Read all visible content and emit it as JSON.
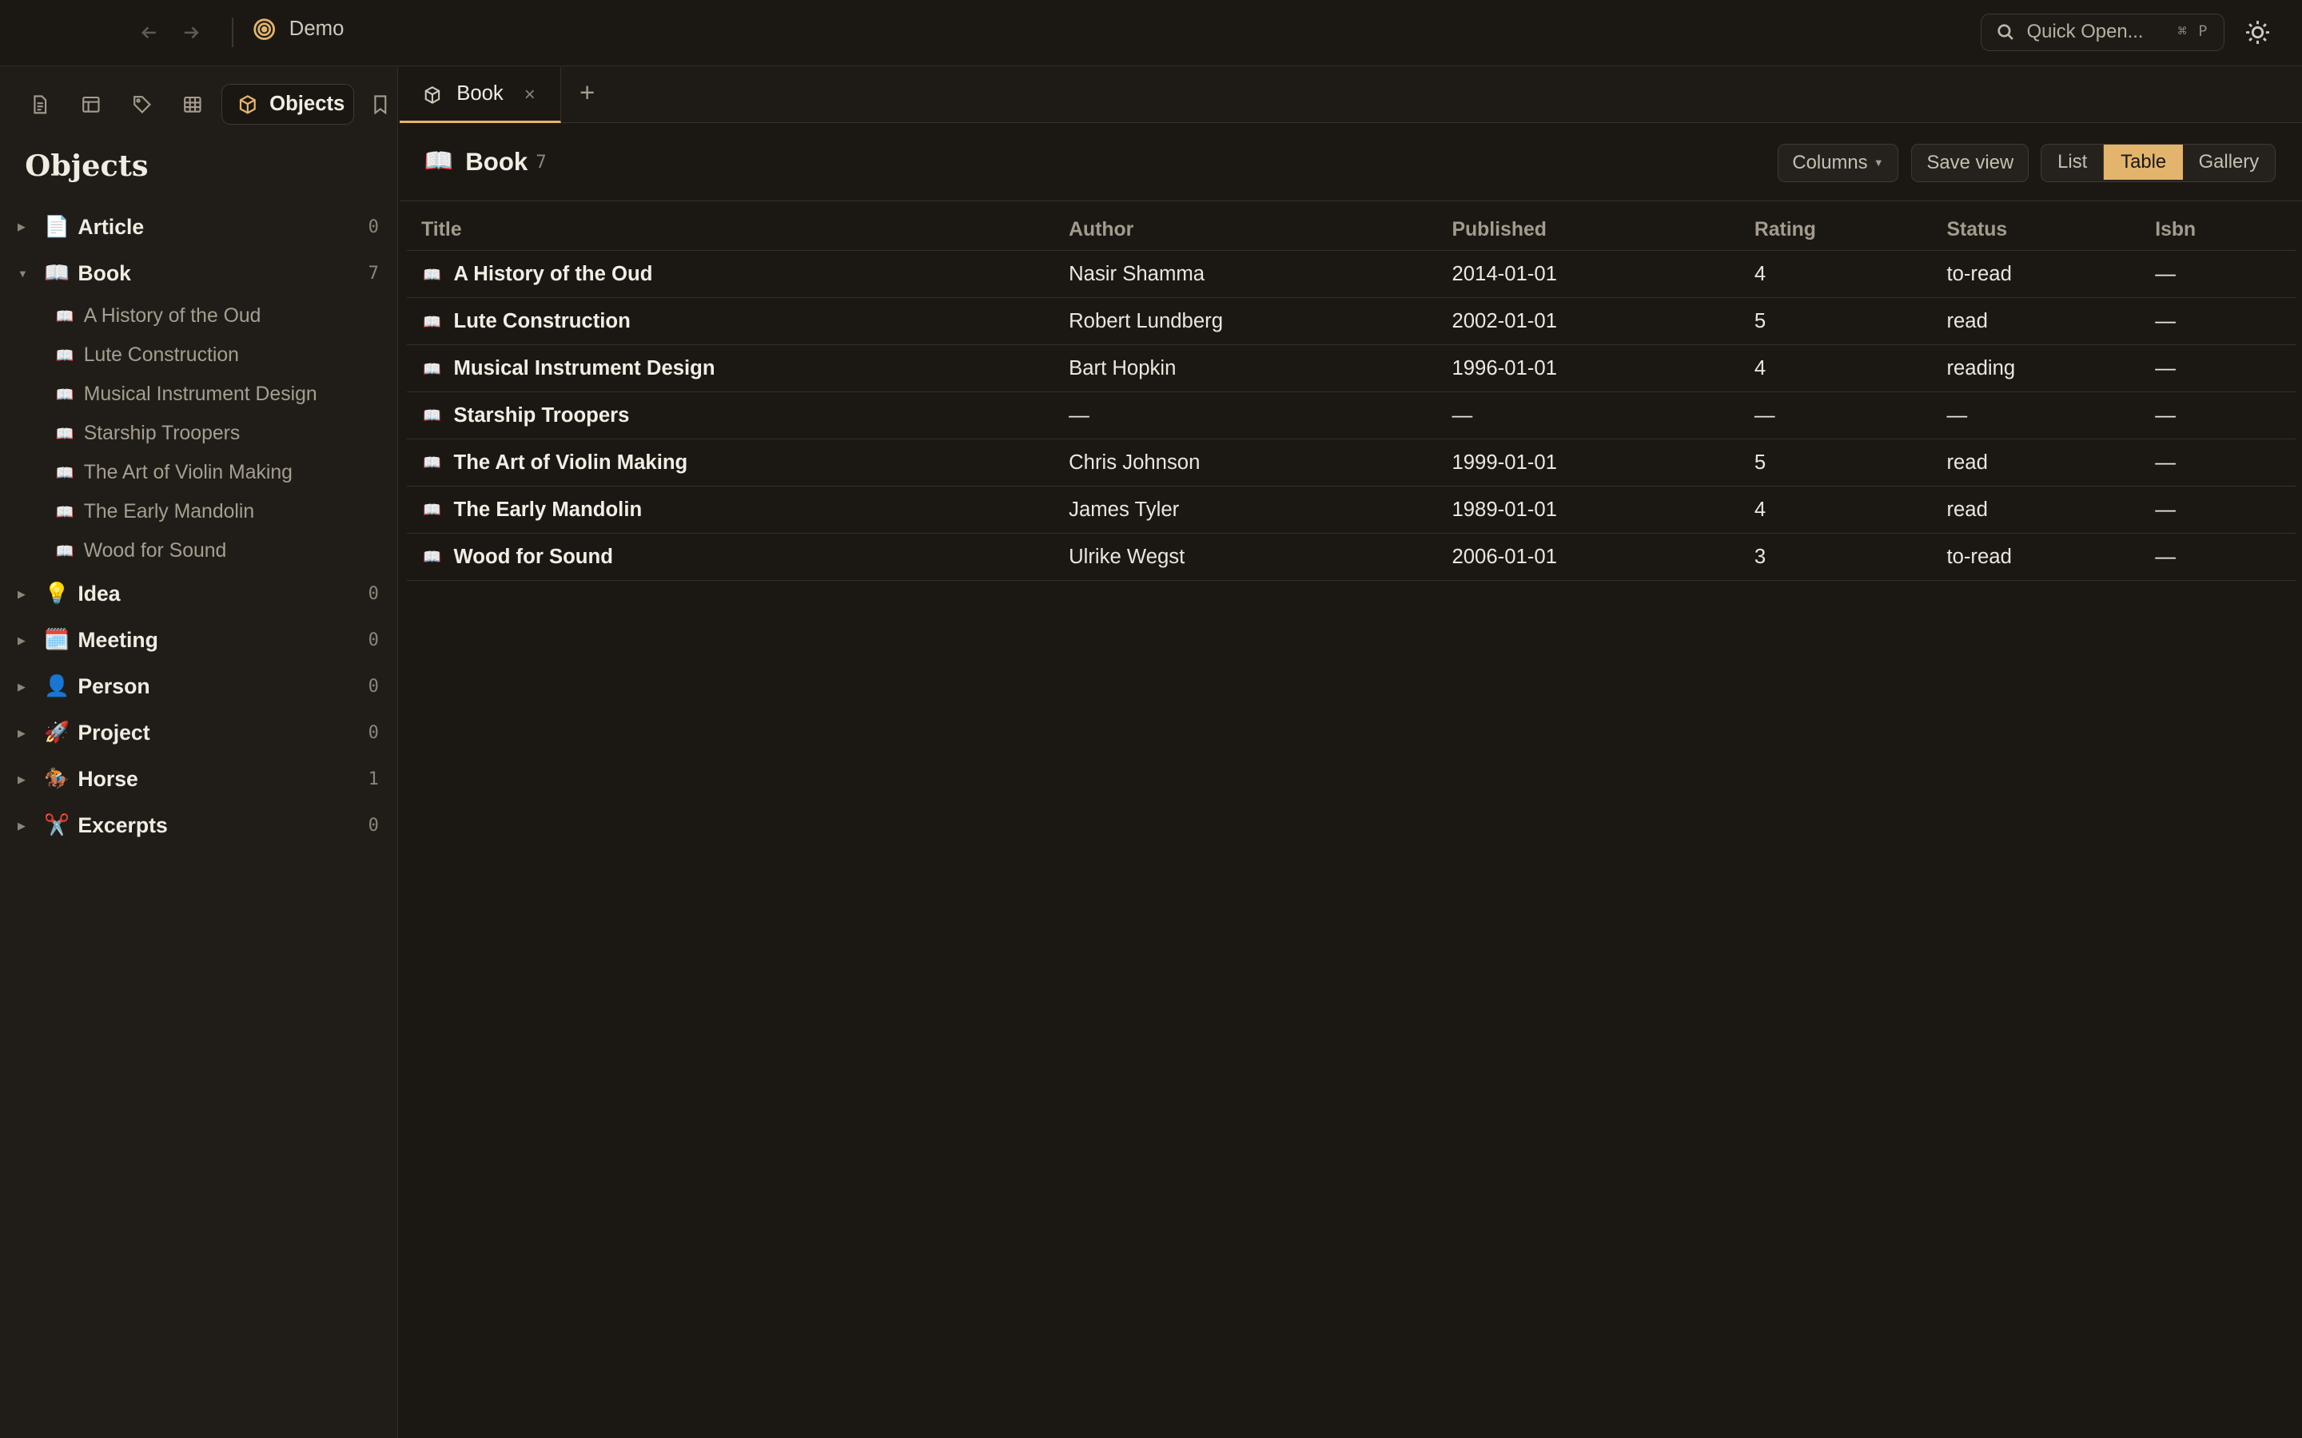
{
  "titlebar": {
    "workspace": "Demo",
    "quick_open_placeholder": "Quick Open...",
    "quick_open_shortcut": "⌘ P"
  },
  "sidebar": {
    "active_tool_label": "Objects",
    "heading": "Objects",
    "groups": [
      {
        "emoji": "📄",
        "name": "Article",
        "count": "0"
      },
      {
        "emoji": "📖",
        "name": "Book",
        "count": "7",
        "expanded": true,
        "children": [
          "A History of the Oud",
          "Lute Construction",
          "Musical Instrument Design",
          "Starship Troopers",
          "The Art of Violin Making",
          "The Early Mandolin",
          "Wood for Sound"
        ]
      },
      {
        "emoji": "💡",
        "name": "Idea",
        "count": "0"
      },
      {
        "emoji": "🗓️",
        "name": "Meeting",
        "count": "0"
      },
      {
        "emoji": "👤",
        "name": "Person",
        "count": "0"
      },
      {
        "emoji": "🚀",
        "name": "Project",
        "count": "0"
      },
      {
        "emoji": "🏇",
        "name": "Horse",
        "count": "1"
      },
      {
        "emoji": "✂️",
        "name": "Excerpts",
        "count": "0"
      }
    ]
  },
  "tabs": [
    {
      "label": "Book",
      "close": "×"
    }
  ],
  "tab_add": "+",
  "view": {
    "emoji": "📖",
    "title": "Book",
    "count": "7",
    "columns_button": "Columns",
    "save_view_button": "Save view",
    "modes": [
      "List",
      "Table",
      "Gallery"
    ],
    "active_mode": "Table"
  },
  "table": {
    "headers": [
      "Title",
      "Author",
      "Published",
      "Rating",
      "Status",
      "Isbn"
    ],
    "rows": [
      [
        "A History of the Oud",
        "Nasir Shamma",
        "2014-01-01",
        "4",
        "to-read",
        "—"
      ],
      [
        "Lute Construction",
        "Robert Lundberg",
        "2002-01-01",
        "5",
        "read",
        "—"
      ],
      [
        "Musical Instrument Design",
        "Bart Hopkin",
        "1996-01-01",
        "4",
        "reading",
        "—"
      ],
      [
        "Starship Troopers",
        "—",
        "—",
        "—",
        "—",
        "—"
      ],
      [
        "The Art of Violin Making",
        "Chris Johnson",
        "1999-01-01",
        "5",
        "read",
        "—"
      ],
      [
        "The Early Mandolin",
        "James Tyler",
        "1989-01-01",
        "4",
        "read",
        "—"
      ],
      [
        "Wood for Sound",
        "Ulrike Wegst",
        "2006-01-01",
        "3",
        "to-read",
        "—"
      ]
    ]
  },
  "colors": {
    "accent": "#e2b46c",
    "background": "#1b1814",
    "sidebar": "#201d19"
  }
}
